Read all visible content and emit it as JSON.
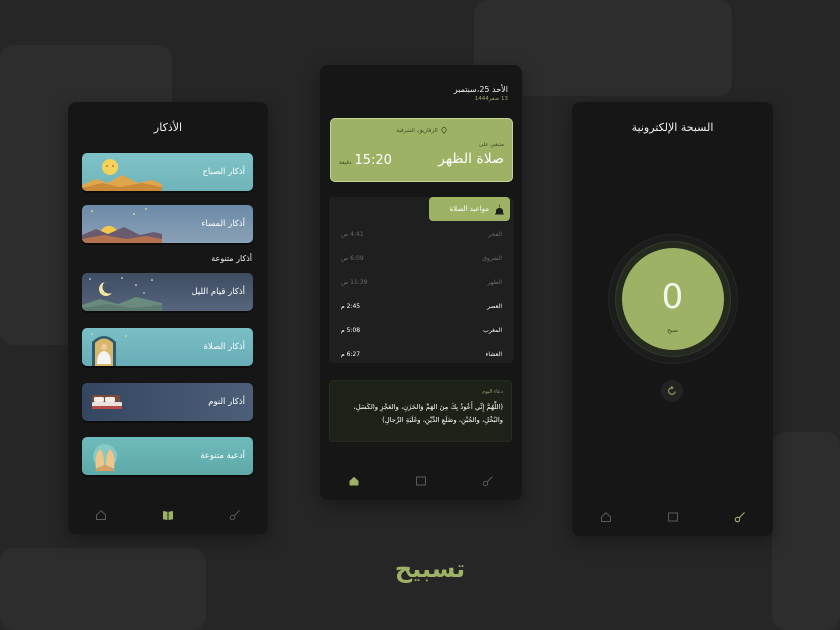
{
  "colors": {
    "background": "#262626",
    "panel": "#161616",
    "accent": "#9eb266",
    "accent_text": "#9aa36a"
  },
  "azkar_screen": {
    "title": "الأذكار",
    "section_label": "أذكار متنوعة",
    "cards": [
      {
        "label": "أذكار الصباح",
        "icon": "sun-icon"
      },
      {
        "label": "أذكار المساء",
        "icon": "sunset-icon"
      },
      {
        "label": "أذكار قيام الليل",
        "icon": "crescent-moon-icon"
      },
      {
        "label": "أذكار الصلاة",
        "icon": "praying-person-icon"
      },
      {
        "label": "أذكار النوم",
        "icon": "bed-icon"
      },
      {
        "label": "أدعية متنوعة",
        "icon": "praying-hands-icon"
      }
    ],
    "nav": [
      "home-icon",
      "book-icon",
      "tasbeeh-icon"
    ]
  },
  "home_screen": {
    "date": "الأحد 25،سبتمبر",
    "hijri_date": "13 صفر1444",
    "next_prayer": {
      "location": "الزقازيق، الشرقية",
      "remaining_label": "متبقي على",
      "prayer_name": "صلاة الظهر",
      "time_left": "15:20",
      "unit": "دقيقة"
    },
    "prayer_times_title": "مواعيد الصلاة",
    "prayer_times": [
      {
        "name": "الفجر",
        "time": "4:41 ص",
        "passed": true
      },
      {
        "name": "الشروق",
        "time": "6:09 ص",
        "passed": true
      },
      {
        "name": "الظهر",
        "time": "11:39 ص",
        "passed": true
      },
      {
        "name": "العصر",
        "time": "2:45 م",
        "passed": false
      },
      {
        "name": "المغرب",
        "time": "5:08 م",
        "passed": false
      },
      {
        "name": "العشاء",
        "time": "6:27 م",
        "passed": false
      }
    ],
    "dua": {
      "title": "دعاء اليوم",
      "text": "(اللَّهُمَّ إِنِّي أَعُوذُ بِكَ مِنَ الهَمِّ وَالحَزَنِ، والعَجْزِ والكَسَلِ، والبُخْلِ، والجُبْنِ، وضَلَعِ الدَّيْنِ، وغَلَبَةِ الرِّجالِ)"
    },
    "nav": [
      "home-icon",
      "book-icon",
      "tasbeeh-icon"
    ]
  },
  "tasbeeh_screen": {
    "title": "السبحة الإلكترونية",
    "count": "0",
    "count_label": "سبح",
    "nav": [
      "home-icon",
      "book-icon",
      "tasbeeh-icon"
    ]
  },
  "brand": "تسبيح"
}
